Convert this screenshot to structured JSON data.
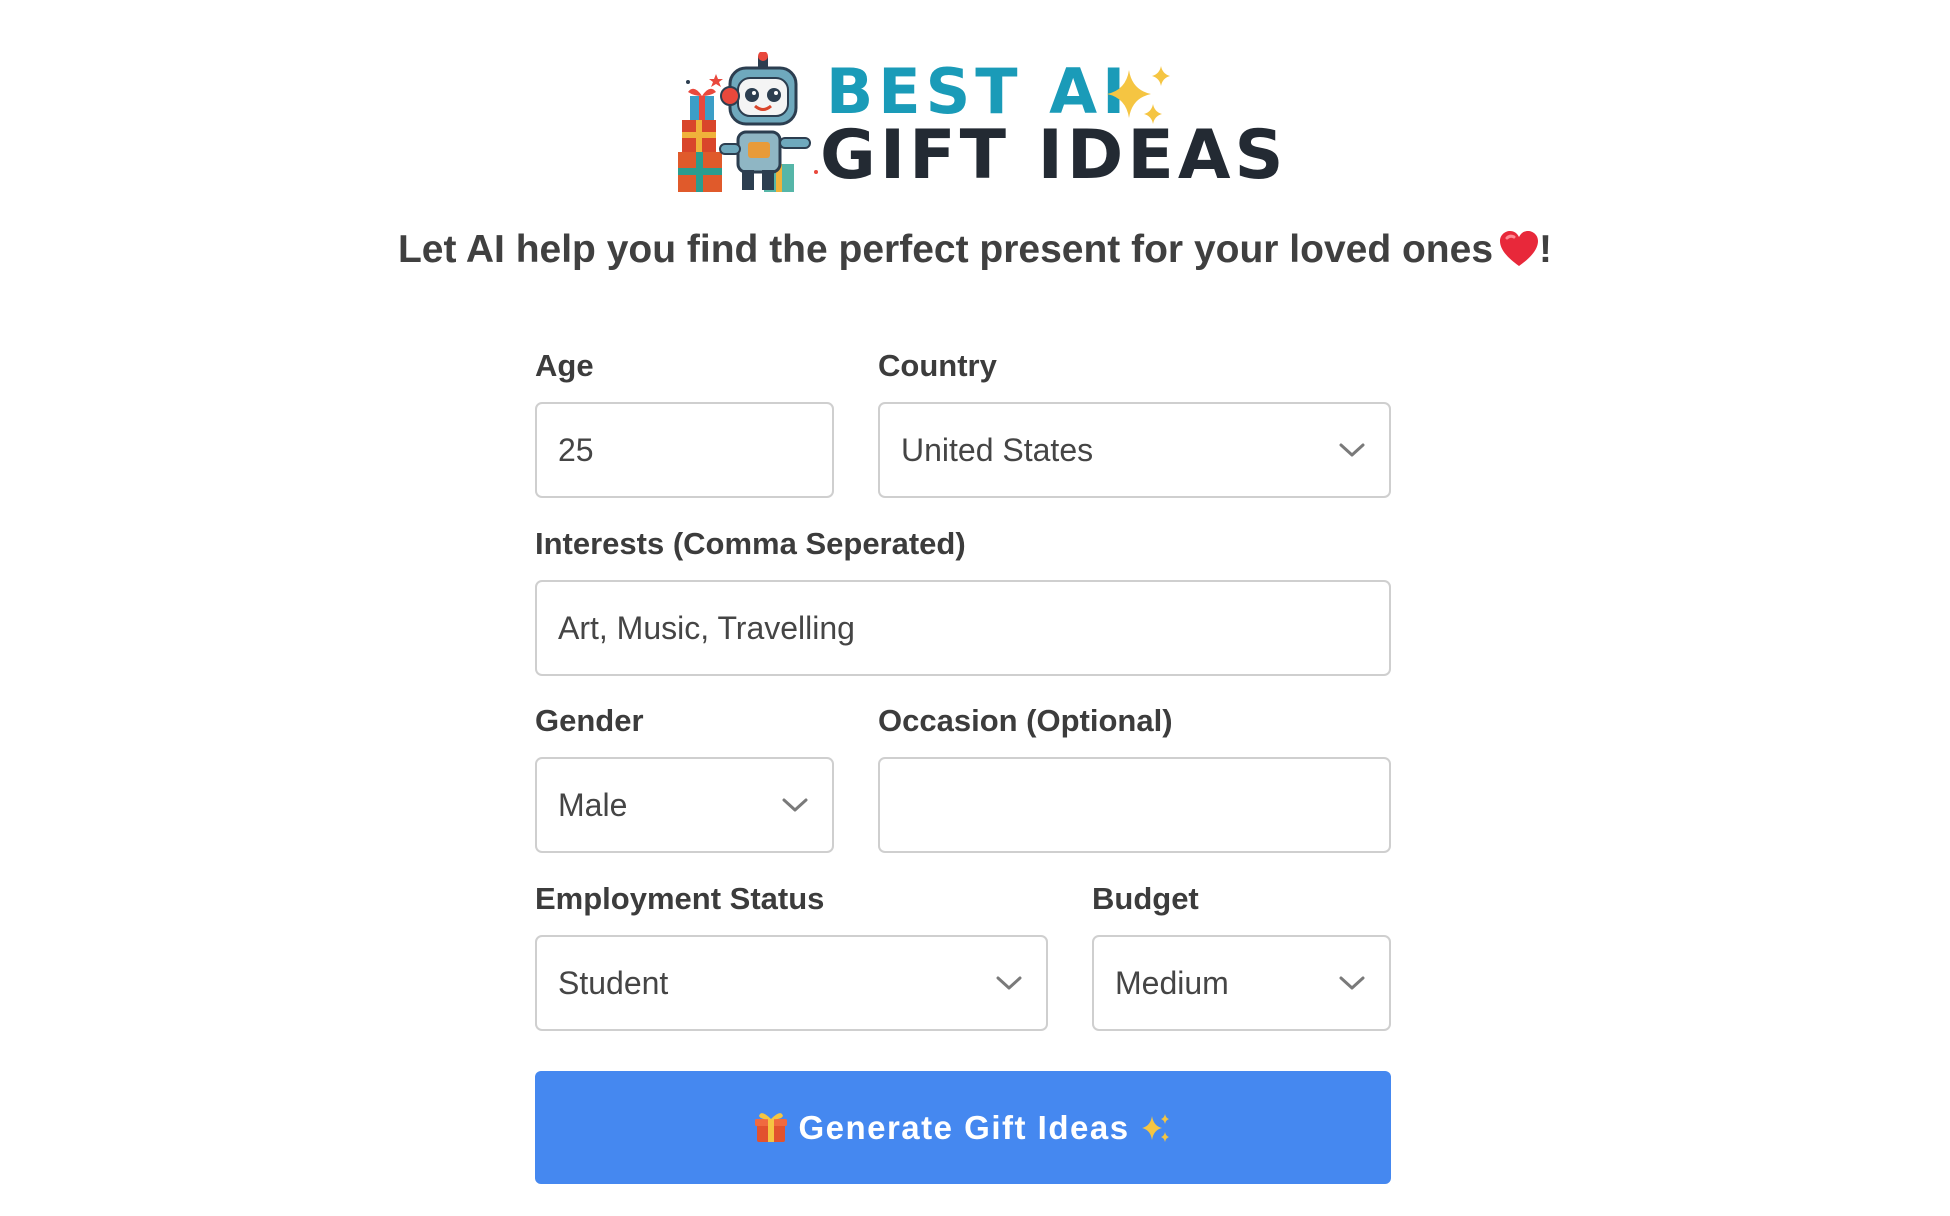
{
  "brand": {
    "line1": "BEST AI",
    "line2": "GIFT IDEAS",
    "logo_icon": "robot-with-gifts-icon",
    "sparkle_icon": "sparkles-icon",
    "colors": {
      "line1": "#1a9bb8",
      "line2": "#232a33",
      "sparkle": "#f5c542"
    }
  },
  "tagline": {
    "text": "Let AI help you find the perfect present for your loved ones",
    "heart_icon": "red-heart-icon",
    "suffix": "!"
  },
  "form": {
    "age": {
      "label": "Age",
      "value": "25"
    },
    "country": {
      "label": "Country",
      "value": "United States"
    },
    "interests": {
      "label": "Interests (Comma Seperated)",
      "value": "Art, Music, Travelling"
    },
    "gender": {
      "label": "Gender",
      "value": "Male"
    },
    "occasion": {
      "label": "Occasion (Optional)",
      "value": ""
    },
    "employment": {
      "label": "Employment Status",
      "value": "Student"
    },
    "budget": {
      "label": "Budget",
      "value": "Medium"
    }
  },
  "button": {
    "label": "Generate Gift Ideas",
    "leading_icon": "gift-icon",
    "trailing_icon": "sparkles-icon",
    "color": "#4588f0"
  }
}
